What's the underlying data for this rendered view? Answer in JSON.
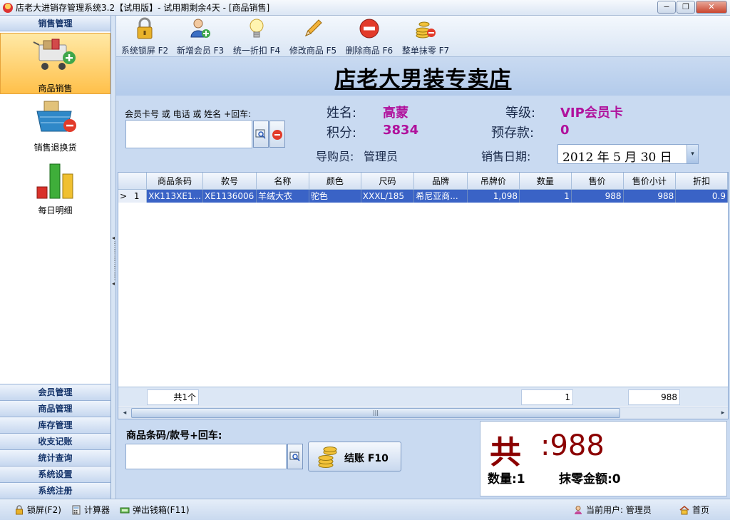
{
  "window": {
    "title": "店老大进销存管理系统3.2【试用版】- 试用期剩余4天 - [商品销售]",
    "minimize": "−",
    "restore": "❐",
    "close": "✕"
  },
  "leftnav": {
    "header": "销售管理",
    "items": [
      {
        "label": "商品销售",
        "icon": "shopping-cart-icon",
        "active": true
      },
      {
        "label": "销售退换货",
        "icon": "return-basket-icon",
        "active": false
      },
      {
        "label": "每日明细",
        "icon": "bar-chart-icon",
        "active": false
      }
    ],
    "groups": [
      "会员管理",
      "商品管理",
      "库存管理",
      "收支记账",
      "统计查询",
      "系统设置",
      "系统注册"
    ]
  },
  "toolbar": {
    "buttons": [
      {
        "label": "系统锁屏 F2",
        "icon": "lock-icon"
      },
      {
        "label": "新增会员 F3",
        "icon": "add-member-icon"
      },
      {
        "label": "统一折扣 F4",
        "icon": "light-bulb-icon"
      },
      {
        "label": "修改商品 F5",
        "icon": "pencil-icon"
      },
      {
        "label": "删除商品 F6",
        "icon": "delete-icon"
      },
      {
        "label": "整单抹零 F7",
        "icon": "coins-icon"
      }
    ]
  },
  "shop": {
    "name": "店老大男装专卖店"
  },
  "member": {
    "search_label": "会员卡号 或 电话 或 姓名 +回车:",
    "name_label": "姓名:",
    "name": "高蒙",
    "points_label": "积分:",
    "points": "3834",
    "level_label": "等级:",
    "level": "VIP会员卡",
    "deposit_label": "预存款:",
    "deposit": "0",
    "guide_label": "导购员:",
    "guide": "管理员",
    "date_label": "销售日期:",
    "date": "2012 年 5 月 30 日"
  },
  "grid": {
    "columns": [
      "",
      "商品条码",
      "款号",
      "名称",
      "颜色",
      "尺码",
      "品牌",
      "吊牌价",
      "数量",
      "售价",
      "售价小计",
      "折扣"
    ],
    "rows": [
      {
        "indicator": ">",
        "index": "1",
        "barcode": "XK113XE1...",
        "style_no": "XE1136006",
        "name": "羊绒大衣",
        "color": "驼色",
        "size": "XXXL/185",
        "brand": "希尼亚商...",
        "tag_price": "1,098",
        "qty": "1",
        "price": "988",
        "subtotal": "988",
        "discount": "0.9"
      }
    ],
    "footer": {
      "count": "共1个",
      "qty_total": "1",
      "subtotal_total": "988"
    }
  },
  "checkout": {
    "scan_label": "商品条码/款号+回车:",
    "button_label": "结账 F10",
    "total_prefix": "共",
    "total": ":988",
    "qty": "数量:1",
    "rounding": "抹零金额:0"
  },
  "statusbar": {
    "lock": "锁屏(F2)",
    "calculator": "计算器",
    "cashbox": "弹出钱箱(F11)",
    "current_user": "当前用户: 管理员",
    "home": "首页"
  }
}
